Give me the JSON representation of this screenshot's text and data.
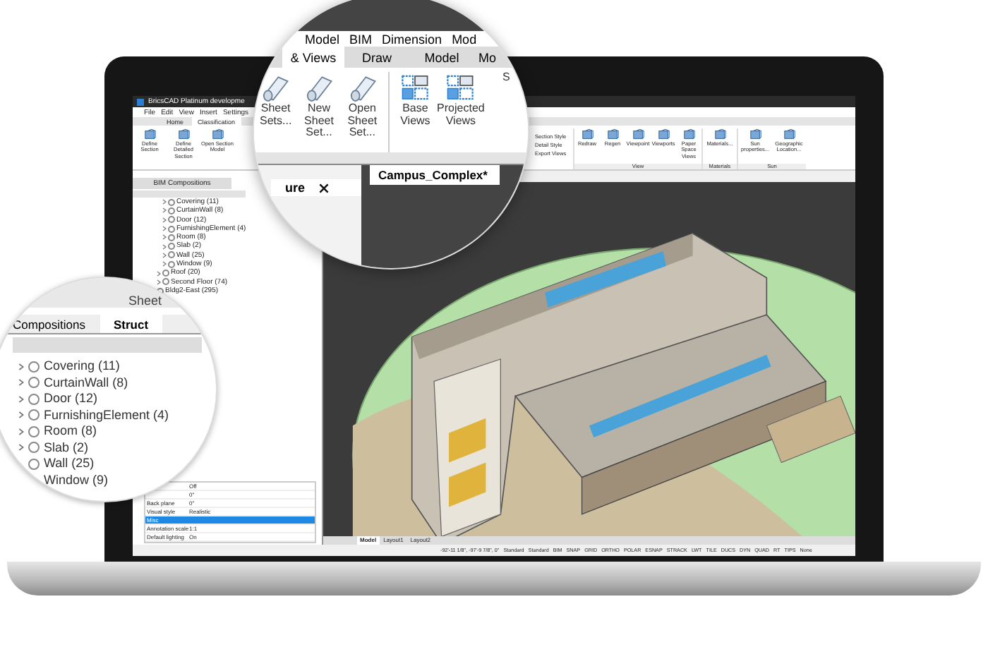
{
  "window": {
    "title": "BricsCAD Platinum developme"
  },
  "menu": [
    "File",
    "Edit",
    "View",
    "Insert",
    "Settings"
  ],
  "ribbon_tabs": [
    {
      "label": "Home",
      "selected": false
    },
    {
      "label": "Classification",
      "selected": true
    }
  ],
  "ribbon_left": [
    "Define Section",
    "Define Detailed Section",
    "Open Section Model"
  ],
  "ribbon_styles": [
    "Section Style",
    "Detail Style",
    "Export Views"
  ],
  "ribbon_groups": [
    {
      "label": "View",
      "buttons": [
        "Redraw",
        "Regen",
        "Viewpoint",
        "Viewports",
        "Paper Space Views"
      ]
    },
    {
      "label": "Materials",
      "buttons": [
        "Materials..."
      ]
    },
    {
      "label": "Sun",
      "buttons": [
        "Sun properties...",
        "Geographic Location..."
      ]
    }
  ],
  "panel": {
    "tabs": [
      {
        "label": "BIM Compositions",
        "selected": false
      }
    ],
    "tree": [
      {
        "expanded": true,
        "children": [
          {
            "expanded": true,
            "children": [
              {
                "label": "Covering (11)"
              },
              {
                "label": "CurtainWall (8)"
              },
              {
                "label": "Door (12)"
              },
              {
                "label": "FurnishingElement (4)"
              },
              {
                "label": "Room (8)"
              },
              {
                "label": "Slab (2)"
              },
              {
                "label": "Wall (25)"
              },
              {
                "label": "Window (9)"
              }
            ]
          },
          {
            "label": "Roof (20)"
          },
          {
            "label": "Second Floor (74)"
          }
        ]
      },
      {
        "label": "Bldg2-East (295)"
      }
    ],
    "properties": [
      {
        "value": "Off",
        "selected": false
      },
      {
        "value": "0\"",
        "selected": false
      },
      {
        "name": "Back plane",
        "value": "0\"",
        "selected": false
      },
      {
        "name": "Visual style",
        "value": "Realistic",
        "selected": false
      },
      {
        "name": "Misc",
        "selected": true
      },
      {
        "name": "Annotation scale",
        "value": "1:1",
        "selected": false
      },
      {
        "name": "Default lighting",
        "value": "On",
        "selected": false
      }
    ]
  },
  "layout_tabs": [
    {
      "label": "Model",
      "selected": true
    },
    {
      "label": "Layout1",
      "selected": false
    },
    {
      "label": "Layout2",
      "selected": false
    }
  ],
  "status_bar": {
    "coordinates": "-92'-11 1/8\", -97'-9 7/8\", 0\"",
    "items": [
      "Standard",
      "Standard",
      "BIM",
      "SNAP",
      "GRID",
      "ORTHO",
      "POLAR",
      "ESNAP",
      "STRACK",
      "LWT",
      "TILE",
      "DUCS",
      "DYN",
      "QUAD",
      "RT",
      "TIPS",
      "None"
    ]
  },
  "magnifier_top": {
    "menu": [
      "Model",
      "BIM",
      "Dimension",
      "Mod"
    ],
    "tabs": [
      {
        "label": "& Views",
        "selected": true
      },
      {
        "label": "Draw",
        "selected": false
      },
      {
        "label": "Model",
        "selected": false
      },
      {
        "label": "Mo",
        "selected": false
      }
    ],
    "buttons": [
      "Sheet Sets...",
      "New Sheet Set...",
      "Open Sheet Set...",
      "Base Views",
      "Projected Views",
      "S"
    ],
    "panel_tab": "ure",
    "document_tab": "Campus_Complex*"
  },
  "magnifier_left": {
    "title": "Sheet",
    "tabs": [
      {
        "label": "Compositions",
        "selected": false
      },
      {
        "label": "Struct",
        "selected": true
      }
    ],
    "tree": [
      "Covering (11)",
      "CurtainWall (8)",
      "Door (12)",
      "FurnishingElement (4)",
      "Room (8)",
      "Slab (2)",
      "Wall (25)",
      "Window (9)"
    ]
  }
}
